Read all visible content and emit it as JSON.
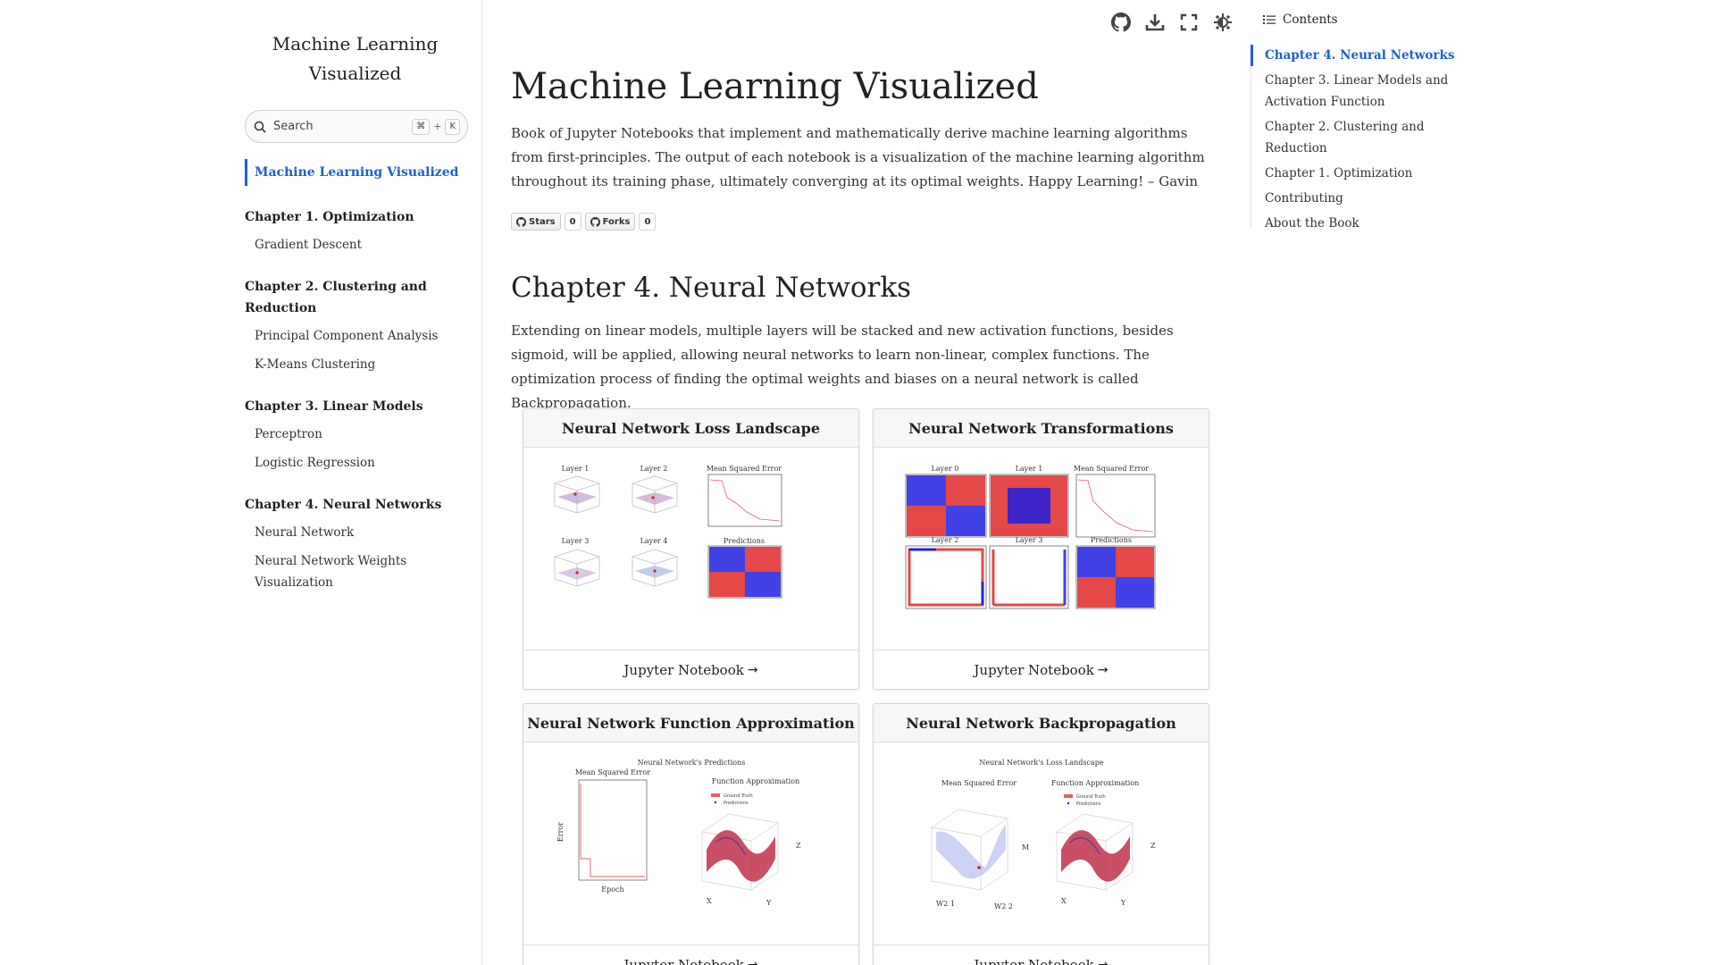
{
  "sidebar": {
    "site_title": "Machine Learning Visualized",
    "search": {
      "placeholder": "Search",
      "shortcut_mod": "⌘",
      "shortcut_plus": "+",
      "shortcut_key": "K"
    },
    "active_item": "Machine Learning Visualized",
    "chapters": [
      {
        "title": "Chapter 1. Optimization",
        "items": [
          "Gradient Descent"
        ]
      },
      {
        "title": "Chapter 2. Clustering and Reduction",
        "items": [
          "Principal Component Analysis",
          "K-Means Clustering"
        ]
      },
      {
        "title": "Chapter 3. Linear Models",
        "items": [
          "Perceptron",
          "Logistic Regression"
        ]
      },
      {
        "title": "Chapter 4. Neural Networks",
        "items": [
          "Neural Network",
          "Neural Network Weights Visualization"
        ]
      }
    ]
  },
  "toolbar": {
    "buttons": [
      {
        "icon": "github-icon",
        "label": "GitHub"
      },
      {
        "icon": "download-icon",
        "label": "Download"
      },
      {
        "icon": "fullscreen-icon",
        "label": "Fullscreen"
      },
      {
        "icon": "theme-icon",
        "label": "Theme"
      }
    ]
  },
  "main": {
    "title": "Machine Learning Visualized",
    "intro": "Book of Jupyter Notebooks that implement and mathematically derive machine learning algorithms from first-principles. The output of each notebook is a visualization of the machine learning algorithm throughout its training phase, ultimately converging at its optimal weights. Happy Learning! – Gavin",
    "badges": {
      "stars_label": "Stars",
      "stars_count": "0",
      "forks_label": "Forks",
      "forks_count": "0"
    },
    "section_title": "Chapter 4. Neural Networks",
    "section_text": "Extending on linear models, multiple layers will be stacked and new activation functions, besides sigmoid, will be applied, allowing neural networks to learn non-linear, complex functions. The optimization process of finding the optimal weights and biases on a neural network is called Backpropagation.",
    "cards": [
      {
        "title": "Neural Network Loss Landscape",
        "link": "Jupyter Notebook",
        "panel_titles": [
          "Layer 1",
          "Layer 2",
          "Mean Squared Error",
          "Layer 3",
          "Layer 4",
          "Predictions"
        ]
      },
      {
        "title": "Neural Network Transformations",
        "link": "Jupyter Notebook",
        "panel_titles": [
          "Layer 0",
          "Layer 1",
          "Mean Squared Error",
          "Layer 2",
          "Layer 3",
          "Predictions"
        ]
      },
      {
        "title": "Neural Network Function Approximation",
        "link": "Jupyter Notebook",
        "suptitle": "Neural Network's Predictions",
        "panel_titles": [
          "Mean Squared Error",
          "Function Approximation"
        ],
        "legend": [
          "Ground Truth",
          "Predictions"
        ],
        "axis_labels": [
          "Error",
          "Epoch",
          "X",
          "Y",
          "Z"
        ]
      },
      {
        "title": "Neural Network Backpropagation",
        "link": "Jupyter Notebook",
        "suptitle": "Neural Network's Loss Landscape",
        "panel_titles": [
          "Mean Squared Error",
          "Function Approximation"
        ],
        "legend": [
          "Ground Truth",
          "Predictions"
        ],
        "axis_labels": [
          "W2 1",
          "W2 2",
          "M",
          "X",
          "Y",
          "Z"
        ]
      }
    ],
    "link_arrow": "→"
  },
  "toc": {
    "header": "Contents",
    "items": [
      "Chapter 4. Neural Networks",
      "Chapter 3. Linear Models and Activation Function",
      "Chapter 2. Clustering and Reduction",
      "Chapter 1. Optimization",
      "Contributing",
      "About the Book"
    ]
  },
  "colors": {
    "accent": "#1f5fd0",
    "red_class": "#e02020",
    "blue_class": "#1a1ad8",
    "loss_curve": "#e06060"
  }
}
